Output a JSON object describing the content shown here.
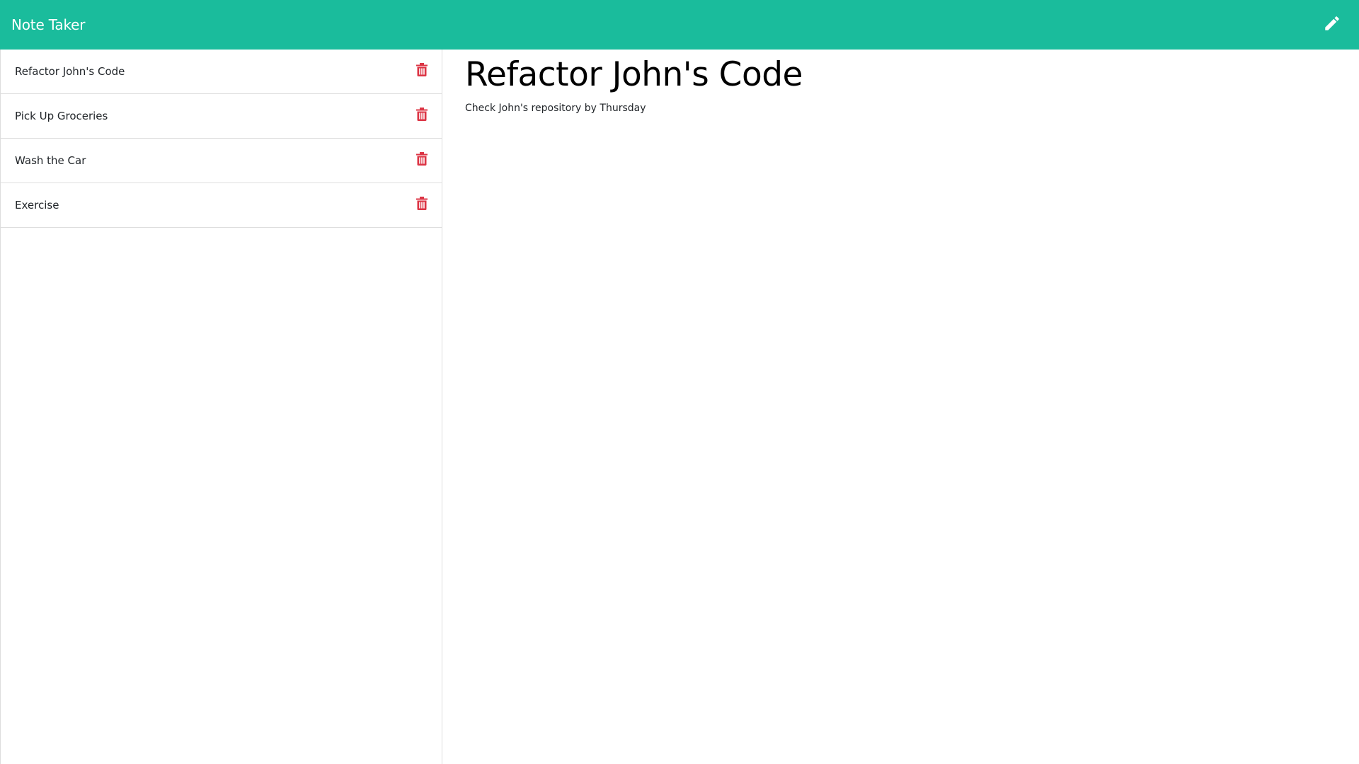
{
  "header": {
    "title": "Note Taker",
    "new_note_icon": "pencil-icon"
  },
  "sidebar": {
    "notes": [
      {
        "title": "Refactor John's Code",
        "delete_icon": "trash-icon"
      },
      {
        "title": "Pick Up Groceries",
        "delete_icon": "trash-icon"
      },
      {
        "title": "Wash the Car",
        "delete_icon": "trash-icon"
      },
      {
        "title": "Exercise",
        "delete_icon": "trash-icon"
      }
    ]
  },
  "active_note": {
    "title": "Refactor John's Code",
    "text": "Check John's repository by Thursday"
  },
  "colors": {
    "navbar": "#1abc9c",
    "delete": "#dc3545",
    "border": "#dddddd"
  }
}
